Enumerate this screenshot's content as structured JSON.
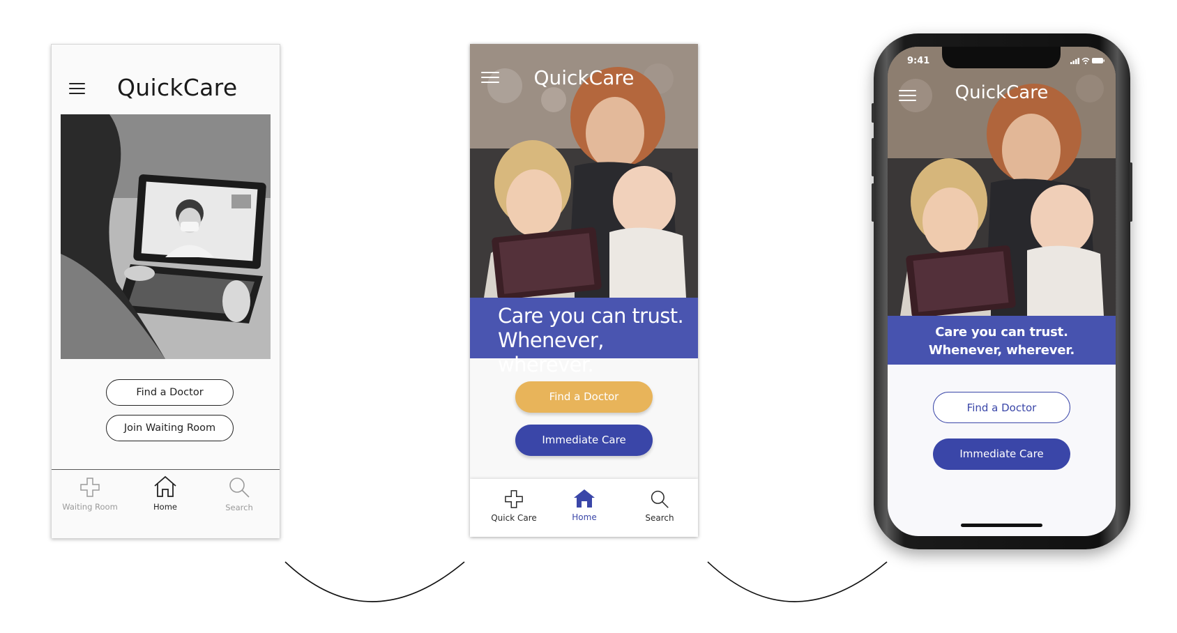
{
  "colors": {
    "primary_blue": "#3a46a8",
    "accent_gold": "#e8b45a",
    "white": "#ffffff",
    "wire_ink": "#222222"
  },
  "wireframe": {
    "app_title": "QuickCare",
    "menu_icon": "hamburger-icon",
    "hero_image": "video-call-doctor-photo",
    "buttons": {
      "find_doctor": "Find a Doctor",
      "join_waiting": "Join Waiting Room"
    },
    "tabs": [
      {
        "label": "Waiting Room",
        "icon": "medical-cross-icon",
        "active": false
      },
      {
        "label": "Home",
        "icon": "home-icon",
        "active": true
      },
      {
        "label": "Search",
        "icon": "search-icon",
        "active": false
      }
    ]
  },
  "hifi": {
    "app_title": "QuickCare",
    "menu_icon": "hamburger-icon",
    "hero_image": "mother-with-children-tablet-photo",
    "tagline_line1": "Care you can trust.",
    "tagline_line2": "Whenever, wherever.",
    "buttons": {
      "find_doctor": "Find a Doctor",
      "immediate_care": "Immediate Care"
    },
    "tabs": [
      {
        "label": "Quick Care",
        "icon": "medical-cross-icon",
        "active": false
      },
      {
        "label": "Home",
        "icon": "home-icon",
        "active": true
      },
      {
        "label": "Search",
        "icon": "search-icon",
        "active": false
      }
    ]
  },
  "device": {
    "status_time": "9:41",
    "status_icons": [
      "signal-icon",
      "wifi-icon",
      "battery-icon"
    ],
    "app_title": "QuickCare",
    "menu_icon": "hamburger-icon",
    "hero_image": "mother-with-children-tablet-photo",
    "tagline_line1": "Care you can trust.",
    "tagline_line2": "Whenever, wherever.",
    "buttons": {
      "find_doctor": "Find a Doctor",
      "immediate_care": "Immediate Care"
    }
  }
}
